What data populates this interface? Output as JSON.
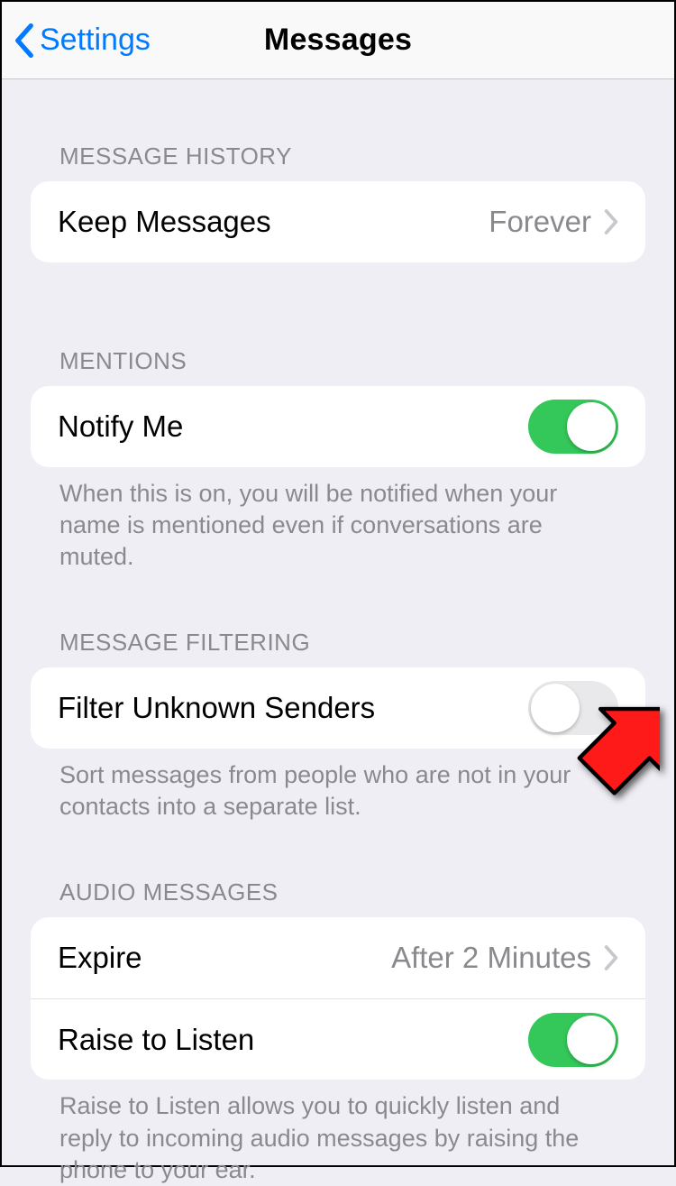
{
  "nav": {
    "back_label": "Settings",
    "title": "Messages"
  },
  "sections": {
    "history": {
      "header": "MESSAGE HISTORY",
      "keep_label": "Keep Messages",
      "keep_value": "Forever"
    },
    "mentions": {
      "header": "MENTIONS",
      "notify_label": "Notify Me",
      "notify_on": true,
      "footer": "When this is on, you will be notified when your name is mentioned even if conversations are muted."
    },
    "filtering": {
      "header": "MESSAGE FILTERING",
      "filter_label": "Filter Unknown Senders",
      "filter_on": false,
      "footer": "Sort messages from people who are not in your contacts into a separate list."
    },
    "audio": {
      "header": "AUDIO MESSAGES",
      "expire_label": "Expire",
      "expire_value": "After 2 Minutes",
      "raise_label": "Raise to Listen",
      "raise_on": true,
      "footer": "Raise to Listen allows you to quickly listen and reply to incoming audio messages by raising the phone to your ear."
    }
  }
}
